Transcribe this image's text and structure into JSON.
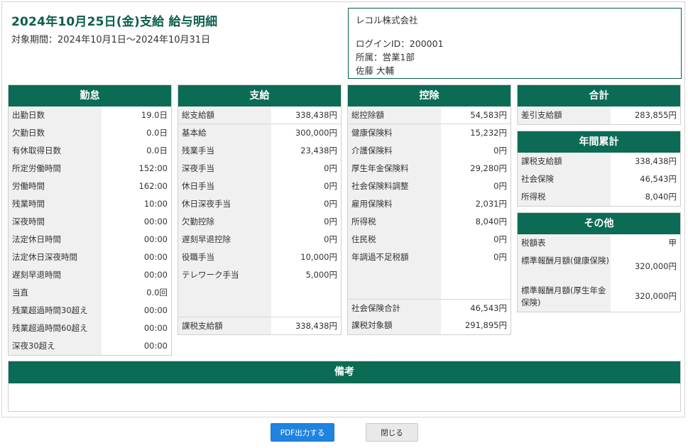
{
  "header": {
    "title": "2024年10月25日(金)支給 給与明細",
    "period": "対象期間：2024年10月1日〜2024年10月31日"
  },
  "company": {
    "name": "レコル株式会社",
    "login_id": "ログインID：200001",
    "department": "所属：営業1部",
    "employee": "佐藤 大輔"
  },
  "attendance": {
    "heading": "勤怠",
    "rows": [
      {
        "label": "出勤日数",
        "value": "19.0日"
      },
      {
        "label": "欠勤日数",
        "value": "0.0日"
      },
      {
        "label": "有休取得日数",
        "value": "0.0日"
      },
      {
        "label": "所定労働時間",
        "value": "152:00"
      },
      {
        "label": "労働時間",
        "value": "162:00"
      },
      {
        "label": "残業時間",
        "value": "10:00"
      },
      {
        "label": "深夜時間",
        "value": "00:00"
      },
      {
        "label": "法定休日時間",
        "value": "00:00"
      },
      {
        "label": "法定休日深夜時間",
        "value": "00:00"
      },
      {
        "label": "遅刻早退時間",
        "value": "00:00"
      },
      {
        "label": "当直",
        "value": "0.0回"
      },
      {
        "label": "残業超過時間30超え",
        "value": "00:00"
      },
      {
        "label": "残業超過時間60超え",
        "value": "00:00"
      },
      {
        "label": "深夜30超え",
        "value": "00:00"
      }
    ]
  },
  "payment": {
    "heading": "支給",
    "total": {
      "label": "総支給額",
      "value": "338,438円"
    },
    "rows": [
      {
        "label": "基本給",
        "value": "300,000円"
      },
      {
        "label": "残業手当",
        "value": "23,438円"
      },
      {
        "label": "深夜手当",
        "value": "0円"
      },
      {
        "label": "休日手当",
        "value": "0円"
      },
      {
        "label": "休日深夜手当",
        "value": "0円"
      },
      {
        "label": "欠勤控除",
        "value": "0円"
      },
      {
        "label": "遅刻早退控除",
        "value": "0円"
      },
      {
        "label": "役職手当",
        "value": "10,000円"
      },
      {
        "label": "テレワーク手当",
        "value": "5,000円"
      }
    ],
    "taxable": {
      "label": "課税支給額",
      "value": "338,438円"
    }
  },
  "deduction": {
    "heading": "控除",
    "total": {
      "label": "総控除額",
      "value": "54,583円"
    },
    "rows": [
      {
        "label": "健康保険料",
        "value": "15,232円"
      },
      {
        "label": "介護保険料",
        "value": "0円"
      },
      {
        "label": "厚生年金保険料",
        "value": "29,280円"
      },
      {
        "label": "社会保険料調整",
        "value": "0円"
      },
      {
        "label": "雇用保険料",
        "value": "2,031円"
      },
      {
        "label": "所得税",
        "value": "8,040円"
      },
      {
        "label": "住民税",
        "value": "0円"
      },
      {
        "label": "年調過不足税額",
        "value": "0円"
      }
    ],
    "social_total": {
      "label": "社会保険合計",
      "value": "46,543円"
    },
    "taxable_target": {
      "label": "課税対象額",
      "value": "291,895円"
    }
  },
  "summary": {
    "heading": "合計",
    "net": {
      "label": "差引支給額",
      "value": "283,855円"
    }
  },
  "annual": {
    "heading": "年間累計",
    "rows": [
      {
        "label": "課税支給額",
        "value": "338,438円"
      },
      {
        "label": "社会保険",
        "value": "46,543円"
      },
      {
        "label": "所得税",
        "value": "8,040円"
      }
    ]
  },
  "other": {
    "heading": "その他",
    "rows": [
      {
        "label": "税額表",
        "value": "甲"
      },
      {
        "label": "標準報酬月額(健康保険)",
        "value": "320,000円"
      },
      {
        "label": "標準報酬月額(厚生年金保険)",
        "value": "320,000円"
      }
    ]
  },
  "remarks": {
    "heading": "備考",
    "text": ""
  },
  "buttons": {
    "pdf": "PDF出力する",
    "close": "閉じる"
  }
}
